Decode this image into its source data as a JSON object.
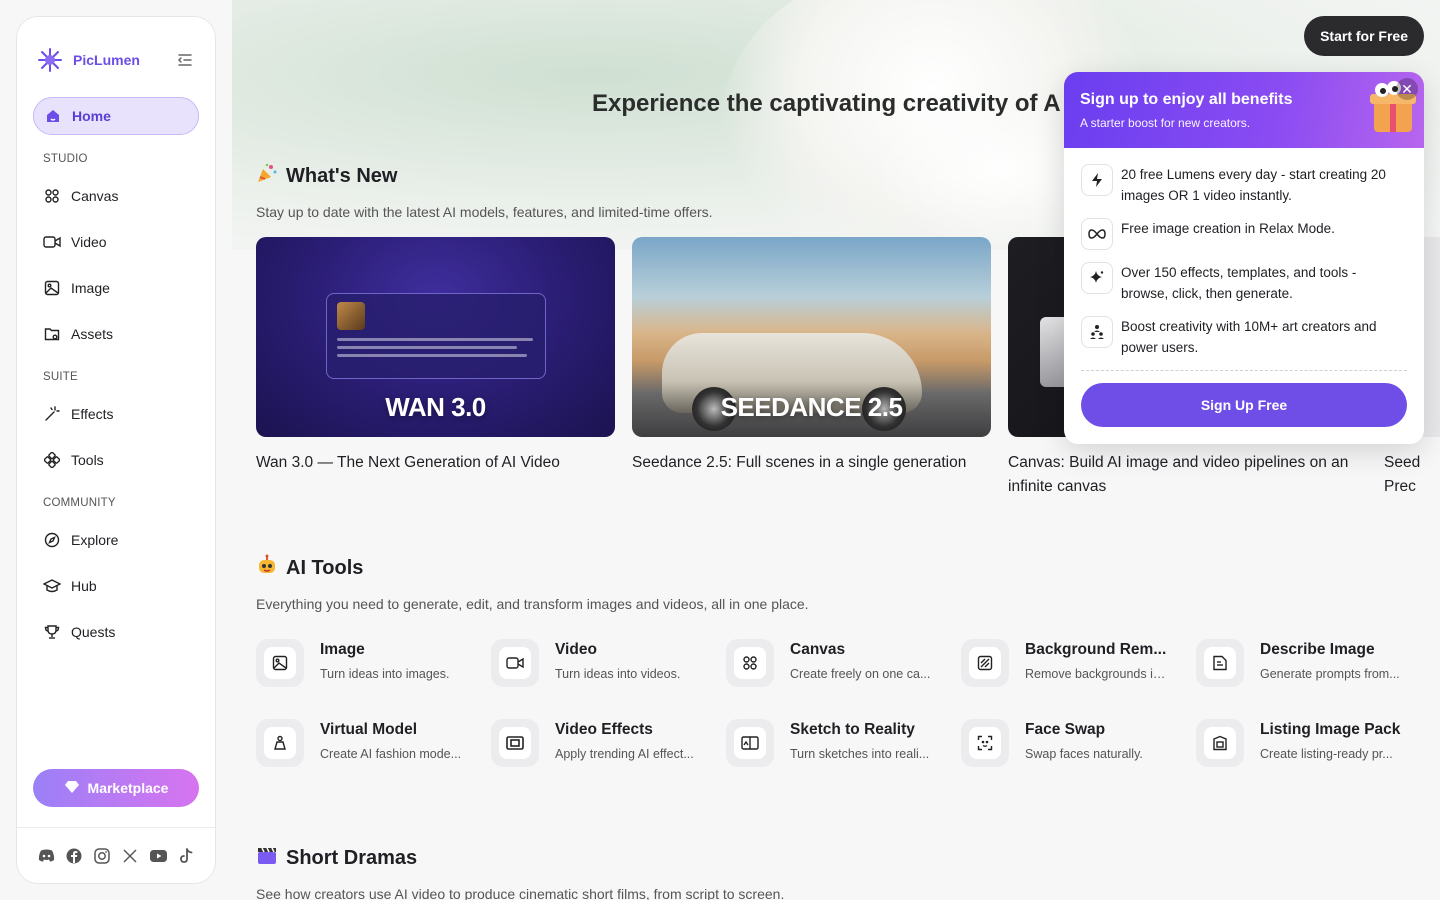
{
  "brand": {
    "name": "PicLumen",
    "accent": "#6d4de8"
  },
  "sidebar": {
    "items": [
      {
        "label": "Home",
        "icon": "home-icon"
      },
      {
        "label": "Canvas",
        "icon": "canvas-icon"
      },
      {
        "label": "Video",
        "icon": "video-icon"
      },
      {
        "label": "Image",
        "icon": "image-icon"
      },
      {
        "label": "Assets",
        "icon": "folder-icon"
      },
      {
        "label": "Effects",
        "icon": "magic-wand-icon"
      },
      {
        "label": "Tools",
        "icon": "tools-icon"
      },
      {
        "label": "Explore",
        "icon": "compass-icon"
      },
      {
        "label": "Hub",
        "icon": "graduation-cap-icon"
      },
      {
        "label": "Quests",
        "icon": "trophy-icon"
      }
    ],
    "sections": {
      "studio": "STUDIO",
      "suite": "SUITE",
      "community": "COMMUNITY"
    },
    "marketplace_label": "Marketplace"
  },
  "header": {
    "hero_title": "Experience the captivating creativity of A",
    "start_label": "Start for Free"
  },
  "whats_new": {
    "title": "What's New",
    "subtitle": "Stay up to date with the latest AI models, features, and limited-time offers.",
    "cards": [
      {
        "image_label": "WAN 3.0",
        "text": "Wan 3.0 — The Next Generation of AI Video"
      },
      {
        "image_label": "SEEDANCE 2.5",
        "text": "Seedance 2.5: Full scenes in a single generation"
      },
      {
        "image_label": "",
        "text": "Canvas: Build AI image and video pipelines on an infinite canvas"
      },
      {
        "image_label": "",
        "text": "Seed Prec"
      }
    ]
  },
  "ai_tools": {
    "title": "AI Tools",
    "subtitle": "Everything you need to generate, edit, and transform images and videos, all in one place.",
    "items": [
      {
        "name": "Image",
        "desc": "Turn ideas into images."
      },
      {
        "name": "Video",
        "desc": "Turn ideas into videos."
      },
      {
        "name": "Canvas",
        "desc": "Create freely on one ca..."
      },
      {
        "name": "Background Rem...",
        "desc": "Remove backgrounds in..."
      },
      {
        "name": "Describe Image",
        "desc": "Generate prompts from..."
      },
      {
        "name": "Virtual Model",
        "desc": "Create AI fashion mode..."
      },
      {
        "name": "Video Effects",
        "desc": "Apply trending AI effect..."
      },
      {
        "name": "Sketch to Reality",
        "desc": "Turn sketches into reali..."
      },
      {
        "name": "Face Swap",
        "desc": "Swap faces naturally."
      },
      {
        "name": "Listing Image Pack",
        "desc": "Create listing-ready pr..."
      }
    ]
  },
  "short_dramas": {
    "title": "Short Dramas",
    "subtitle": "See how creators use AI video to produce cinematic short films, from script to screen."
  },
  "popup": {
    "title": "Sign up to enjoy all benefits",
    "subtitle": "A starter boost for new creators.",
    "benefits": [
      "20 free Lumens every day - start creating 20 images OR 1 video instantly.",
      "Free image creation in Relax Mode.",
      "Over 150 effects, templates, and tools - browse, click, then generate.",
      "Boost creativity with 10M+ art creators and power users."
    ],
    "cta": "Sign Up Free"
  }
}
